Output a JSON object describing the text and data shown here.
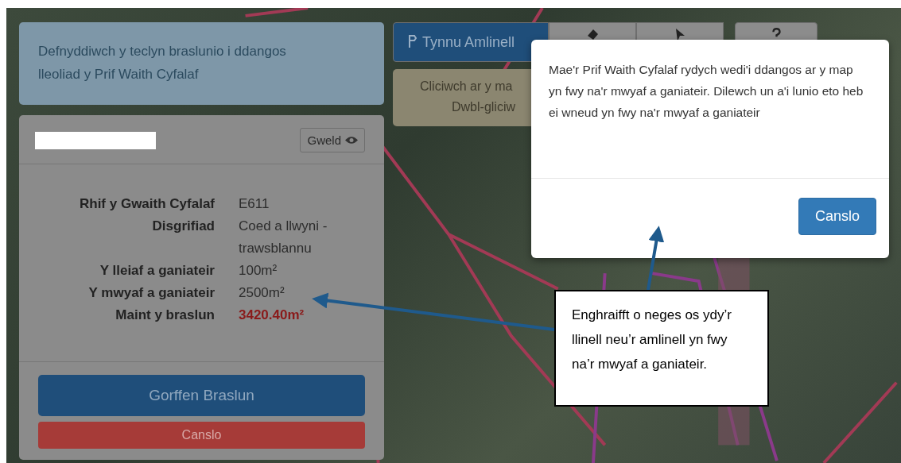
{
  "instruction": "Defnyddiwch y teclyn braslunio i ddangos lleoliad y Prif Waith Cyfalaf",
  "card": {
    "view_button": "Gweld",
    "details": [
      {
        "label": "Rhif y Gwaith Cyfalaf",
        "value": "E611",
        "kind": "normal"
      },
      {
        "label": "Disgrifiad",
        "value": "Coed a llwyni - trawsblannu",
        "kind": "normal"
      },
      {
        "label": "Y lleiaf a ganiateir",
        "value": "100m²",
        "kind": "normal"
      },
      {
        "label": "Y mwyaf a ganiateir",
        "value": "2500m²",
        "kind": "normal"
      },
      {
        "label": "Maint y braslun",
        "value": "3420.40m²",
        "kind": "warning"
      }
    ],
    "finish_button": "Gorffen Braslun",
    "cancel_button": "Canslo"
  },
  "toolbar": [
    {
      "kind": "draw",
      "label": "Tynnu Amlinell",
      "selected": true
    },
    {
      "kind": "delete",
      "selected": false
    },
    {
      "kind": "select",
      "selected": false
    },
    {
      "kind": "help",
      "selected": false
    }
  ],
  "hint": [
    "Cliciwch ar y ma",
    "Dwbl-gliciw"
  ],
  "modal": {
    "message": "Mae'r Prif Waith Cyfalaf rydych wedi'i ddangos ar y map yn fwy na'r mwyaf a ganiateir. Dilewch un a'i lunio eto heb ei wneud yn fwy na'r mwyaf a ganiateir",
    "button": "Canslo"
  },
  "annotation": "Enghraifft o neges os ydy’r llinell neu’r amlinell yn fwy na’r mwyaf a ganiateir."
}
